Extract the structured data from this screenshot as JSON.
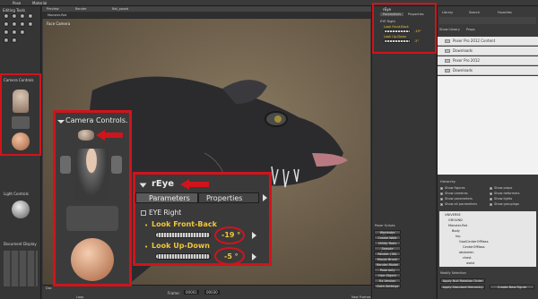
{
  "menubar": {
    "items": [
      "Pose",
      "Material"
    ]
  },
  "left": {
    "editing_tools": "Editing Tools",
    "camera_controls": "Camera Controls",
    "light_controls": "Light Controls",
    "document_display": "Document Display"
  },
  "viewport": {
    "tabs": [
      "Preview",
      "Render",
      "Rat_posed"
    ],
    "figure_select": "Monster-Rat",
    "camera_label": "Face Camera"
  },
  "timeline": {
    "docs_label": "Doc",
    "frame_label": "Frame:",
    "frame_value": "00001",
    "total_value": "00030",
    "loop_label": "Loop",
    "new_frames_label": "New Frames"
  },
  "param_panel": {
    "title": "rEye",
    "tabs": [
      "Parameters",
      "Properties"
    ],
    "group": "EYE Right",
    "params": [
      {
        "label": "Look Front-Back",
        "value": "-19"
      },
      {
        "label": "Look Up-Down",
        "value": "-5"
      }
    ],
    "pose_scripts": {
      "title": "Poser Scripts",
      "buttons": [
        "Wardrobe Wizard",
        "Create Walk",
        "Utility Tools",
        "Sample Calibrate",
        "Render / IBL",
        "Morph Brush",
        "Render Model",
        "Pose only",
        "Hair Object",
        "Fix Version",
        "Cloth Settings"
      ]
    }
  },
  "library": {
    "tabs": [
      "Library",
      "Search",
      "Favorites"
    ],
    "show_library_label": "Show Library",
    "path": "Props",
    "rows": [
      "Poser Pro 2012 Content",
      "Downloads",
      "Poser Pro 2012",
      "Downloads"
    ],
    "hierarchy": {
      "title": "Hierarchy",
      "checks_left": [
        "Show figures",
        "Show cameras",
        "Show parameters",
        "Show all parameters"
      ],
      "checks_right": [
        "Show props",
        "Show deformers",
        "Show lights",
        "Show groupings"
      ],
      "tree": [
        "UNIVERSE",
        "GROUND",
        "Monster-Rat",
        "Body",
        "hip",
        "GoalCenterOfMass",
        "CenterOfMass",
        "abdomen",
        "chest",
        "waist"
      ],
      "modify_title": "Modify Selection",
      "btn_apply_rotation": "Apply Null Rotation Order",
      "btn_apply_standard": "Apply Standard Hierarchy",
      "btn_create_new": "Create New Figure"
    }
  },
  "callout_camera": {
    "title": "Camera Controls."
  },
  "callout_params": {
    "title": "rEye",
    "tab_params": "Parameters",
    "tab_props": "Properties",
    "group": "EYE Right",
    "p1_label": "Look Front-Back",
    "p1_value": "-19 °",
    "p2_label": "Look Up-Down",
    "p2_value": "-5 °"
  },
  "small_panel": {
    "title": "rEye",
    "tab_params": "Parameters",
    "tab_props": "Properties",
    "group": "EYE Right",
    "p1_label": "Look Front-Back",
    "p1_value": "-19°",
    "p2_label": "Look Up-Down",
    "p2_value": "-5°"
  },
  "colors": {
    "highlight": "#d0141c",
    "param_text": "#f0c63a"
  }
}
